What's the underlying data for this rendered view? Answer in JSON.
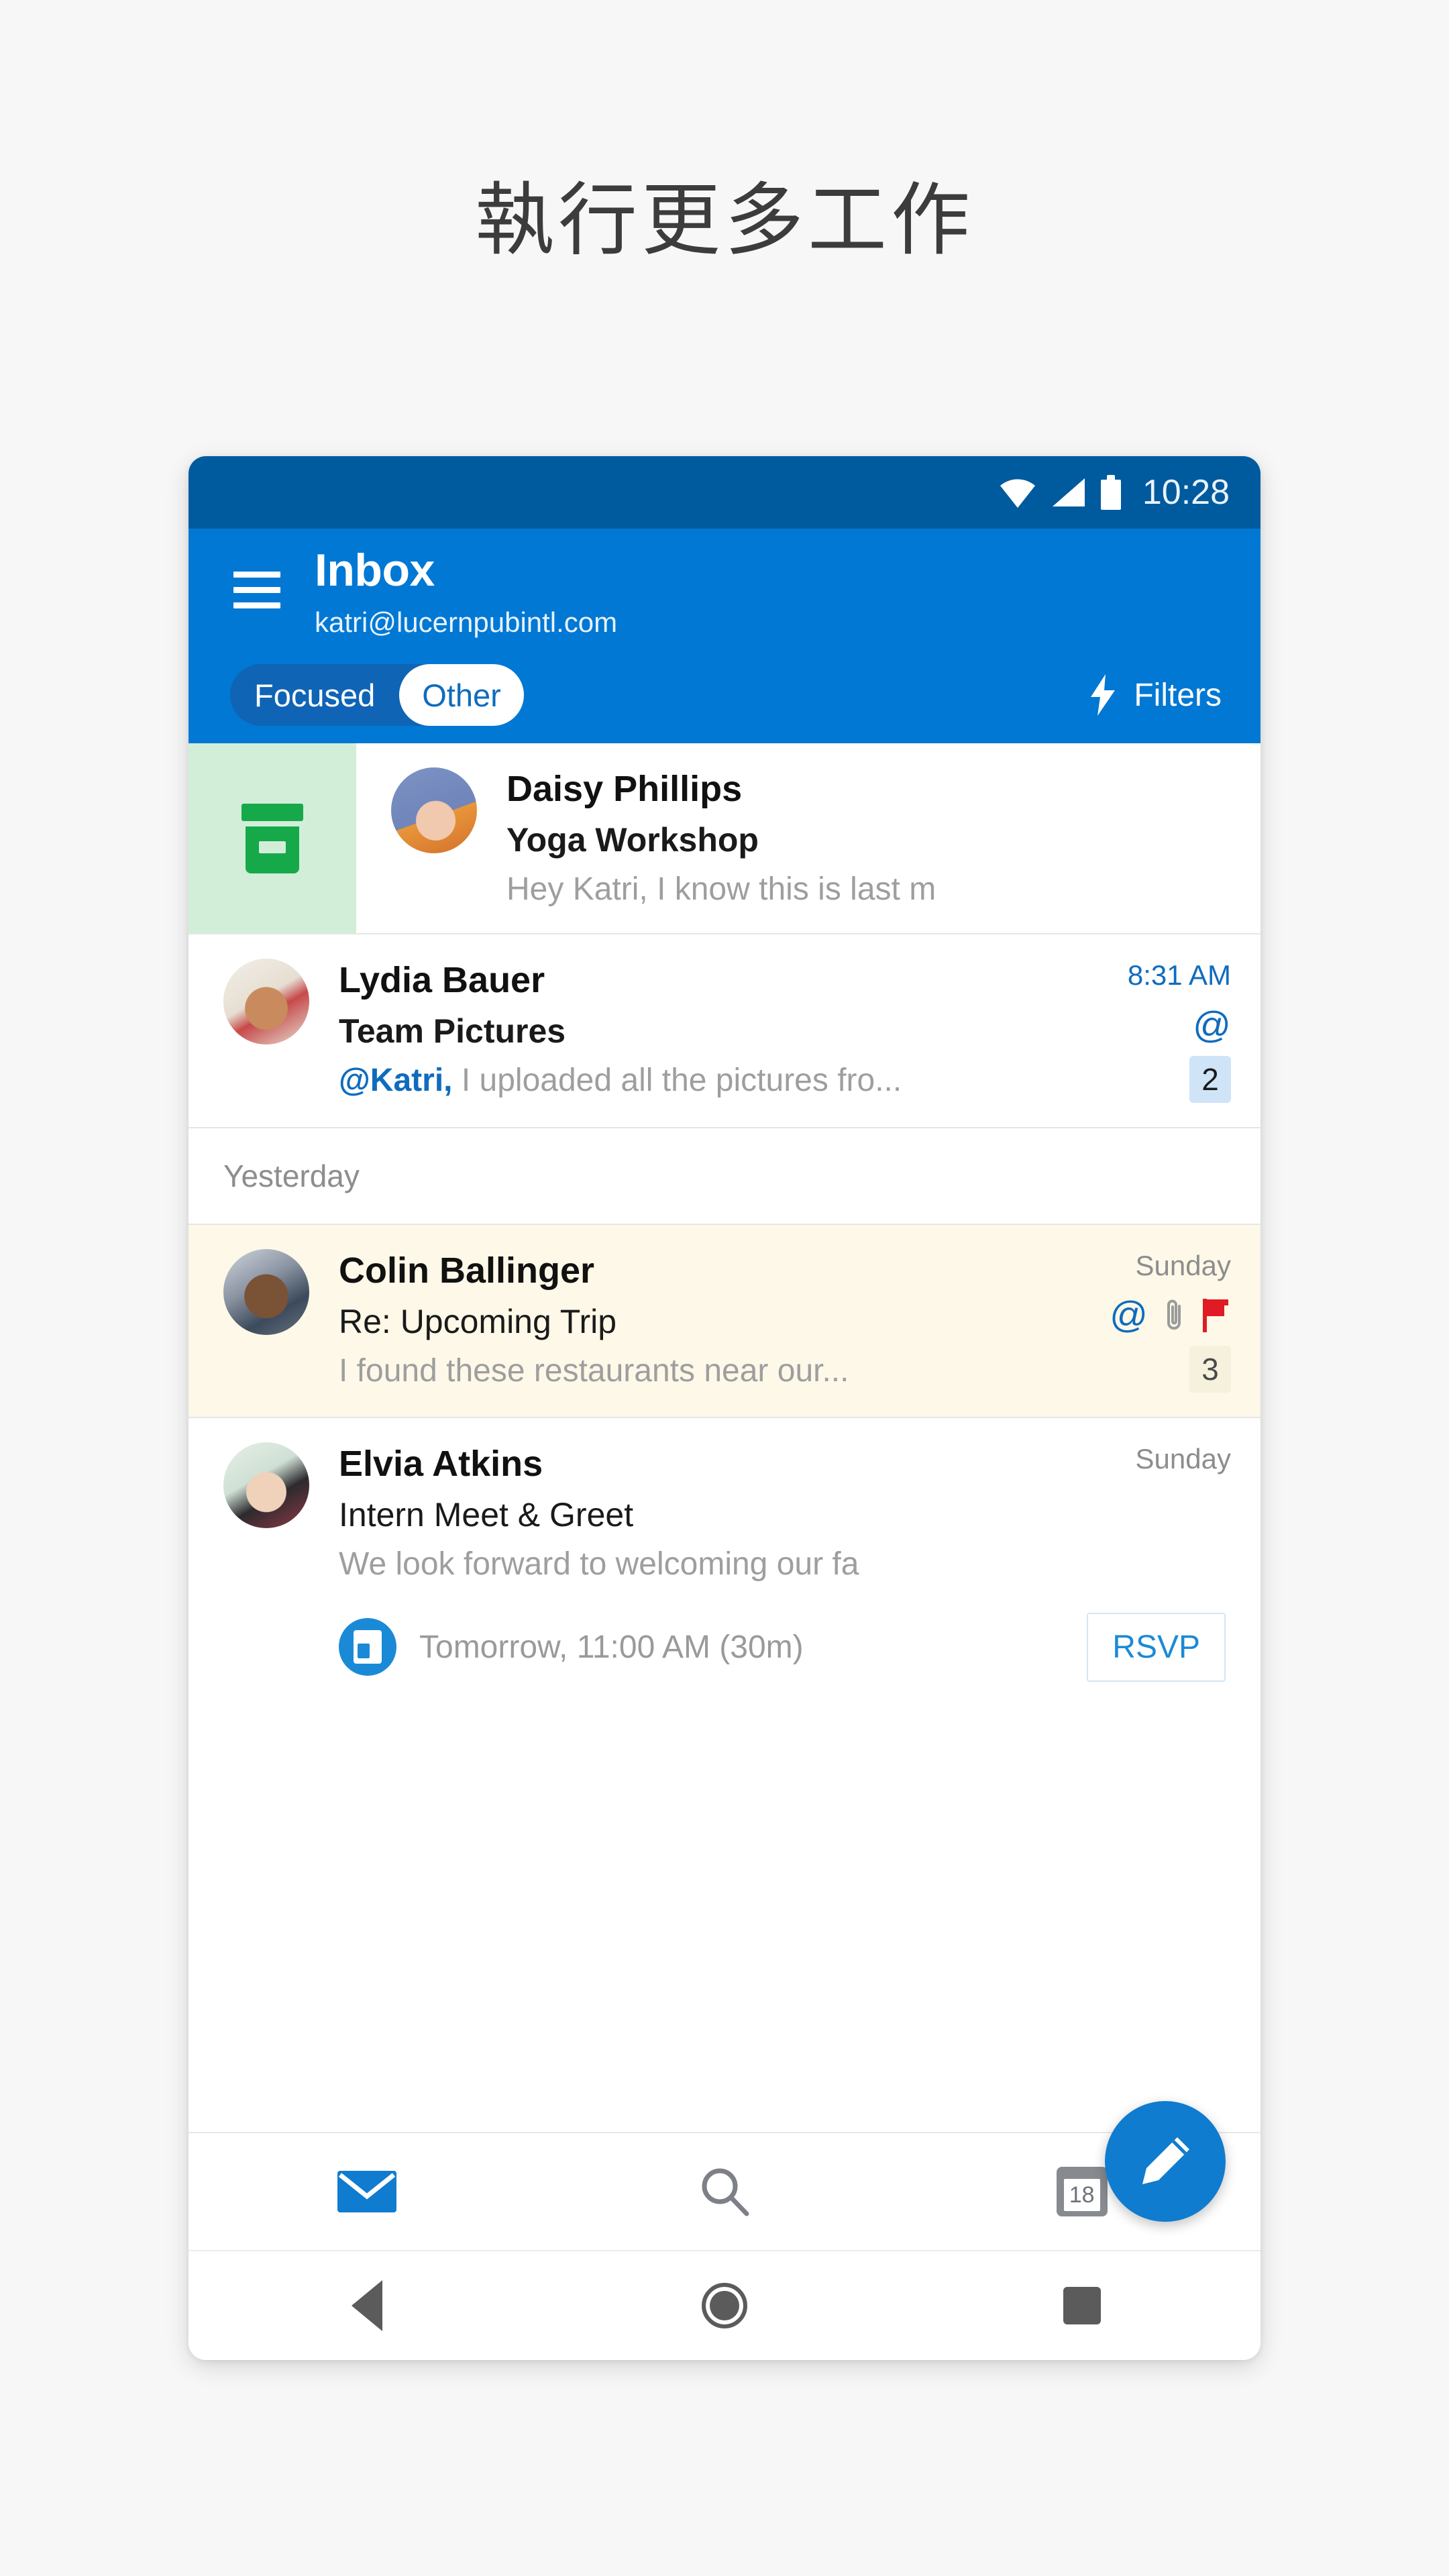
{
  "headline": "執行更多工作",
  "status_bar": {
    "time": "10:28",
    "icons": [
      "wifi-icon",
      "cellular-signal-icon",
      "battery-icon"
    ]
  },
  "app_bar": {
    "menu_icon": "hamburger-menu-icon",
    "title": "Inbox",
    "account": "katri@lucernpubintl.com",
    "segmented": {
      "options": [
        "Focused",
        "Other"
      ],
      "selected": "Other"
    },
    "filters": {
      "icon": "lightning-bolt-icon",
      "label": "Filters"
    },
    "accent": "#0078d4",
    "status_accent": "#005a9e"
  },
  "messages": [
    {
      "sender": "Daisy Phillips",
      "subject": "Yoga Workshop",
      "preview": "Hey Katri, I know this is last m",
      "time": "",
      "swipe_action": "archive",
      "swipe_color": "#d2eed9",
      "flagged": false
    },
    {
      "sender": "Lydia Bauer",
      "subject": "Team Pictures",
      "preview_mention": "@Katri,",
      "preview": " I uploaded all the pictures fro...",
      "time": "8:31 AM",
      "icons": [
        "at-mention-icon"
      ],
      "count": "2",
      "flagged": false
    },
    {
      "sender": "Colin Ballinger",
      "subject": "Re: Upcoming Trip",
      "preview": "I found these restaurants near our...",
      "time": "Sunday",
      "icons": [
        "at-mention-icon",
        "paperclip-icon",
        "flag-icon"
      ],
      "count": "3",
      "flagged": true
    },
    {
      "sender": "Elvia Atkins",
      "subject": "Intern Meet & Greet",
      "preview": "We look forward to welcoming our fa",
      "time": "Sunday",
      "flagged": false,
      "event": {
        "icon": "calendar-event-icon",
        "text": "Tomorrow, 11:00 AM (30m)",
        "rsvp_label": "RSVP"
      }
    }
  ],
  "section_headers": {
    "yesterday": "Yesterday"
  },
  "fab": {
    "icon": "compose-pencil-icon",
    "color": "#0f7ccf"
  },
  "bottom_nav": [
    {
      "name": "mail",
      "icon": "mail-icon",
      "active": true
    },
    {
      "name": "search",
      "icon": "search-icon",
      "active": false
    },
    {
      "name": "calendar",
      "icon": "calendar-icon",
      "active": false,
      "day": "18"
    }
  ],
  "android_nav": [
    "back-icon",
    "home-icon",
    "recents-icon"
  ]
}
